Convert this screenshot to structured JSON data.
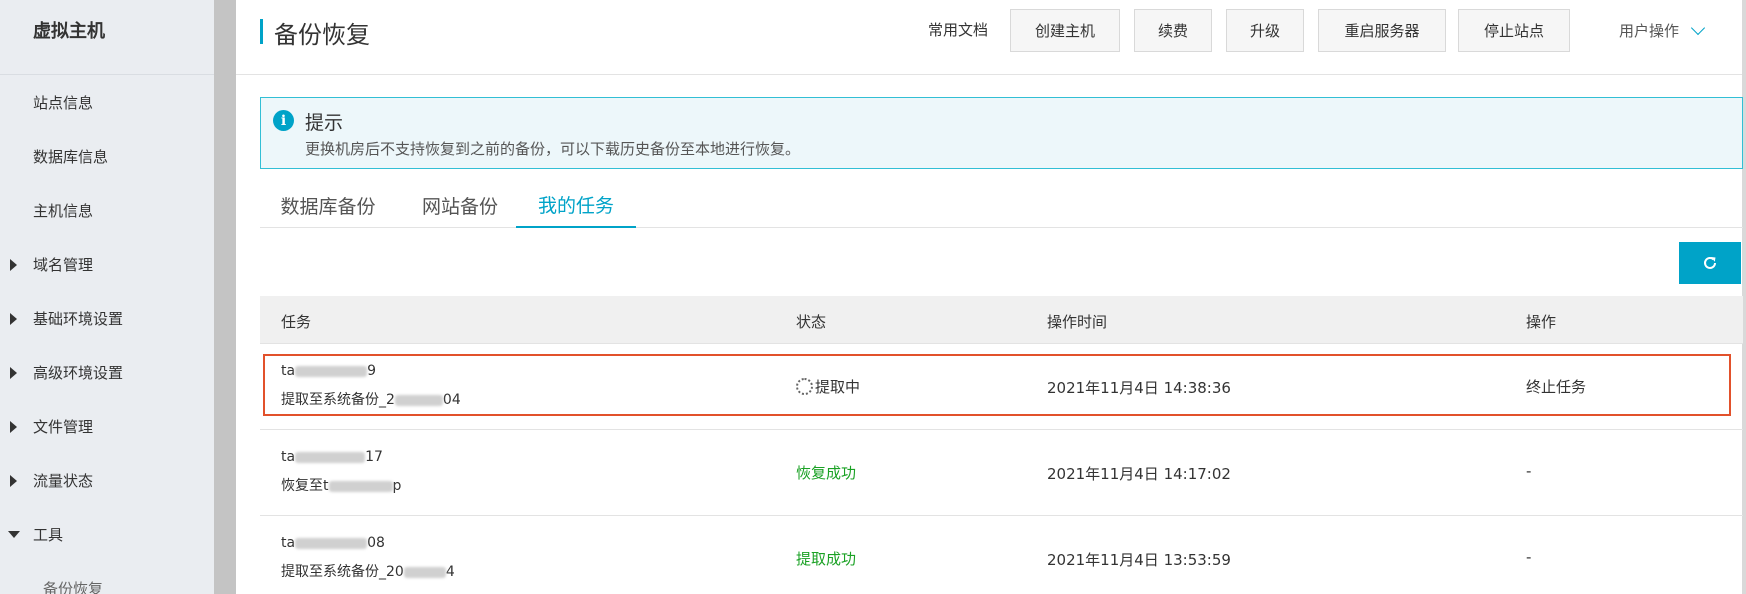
{
  "sidebar": {
    "title": "虚拟主机",
    "items": [
      {
        "label": "站点信息"
      },
      {
        "label": "数据库信息"
      },
      {
        "label": "主机信息"
      },
      {
        "label": "域名管理"
      },
      {
        "label": "基础环境设置"
      },
      {
        "label": "高级环境设置"
      },
      {
        "label": "文件管理"
      },
      {
        "label": "流量状态"
      },
      {
        "label": "工具"
      },
      {
        "label": "备份恢复"
      }
    ]
  },
  "header": {
    "title": "备份恢复",
    "doc_link": "常用文档",
    "buttons": [
      "创建主机",
      "续费",
      "升级",
      "重启服务器",
      "停止站点"
    ],
    "user_menu": "用户操作"
  },
  "notice": {
    "title": "提示",
    "text": "更换机房后不支持恢复到之前的备份，可以下载历史备份至本地进行恢复。"
  },
  "tabs": [
    {
      "label": "数据库备份"
    },
    {
      "label": "网站备份"
    },
    {
      "label": "我的任务"
    }
  ],
  "table": {
    "headers": [
      "任务",
      "状态",
      "操作时间",
      "操作"
    ],
    "rows": [
      {
        "task_prefix": "ta",
        "task_suffix": "9",
        "desc_prefix": "提取至系统备份_2",
        "desc_suffix": "04",
        "status": "提取中",
        "time": "2021年11月4日 14:38:36",
        "action": "终止任务"
      },
      {
        "task_prefix": "ta",
        "task_suffix": "17",
        "desc_prefix": "恢复至t",
        "desc_suffix": "p",
        "status": "恢复成功",
        "time": "2021年11月4日 14:17:02",
        "action": "-"
      },
      {
        "task_prefix": "ta",
        "task_suffix": "08",
        "desc_prefix": "提取至系统备份_20",
        "desc_suffix": "4",
        "status": "提取成功",
        "time": "2021年11月4日 13:53:59",
        "action": "-"
      }
    ]
  },
  "colors": {
    "accent": "#00a3c8",
    "success": "#1aa124",
    "link": "#0077cc",
    "highlight": "#e2512b"
  }
}
